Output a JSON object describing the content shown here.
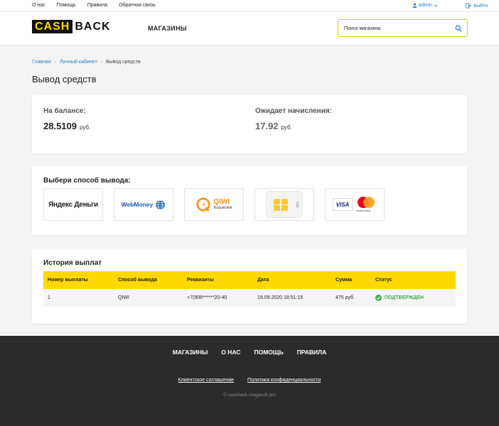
{
  "topbar": {
    "links": [
      "О нас",
      "Помощь",
      "Правила",
      "Обратная связь"
    ],
    "user": "admin",
    "logout": "выйти"
  },
  "header": {
    "logo_part1": "CASH",
    "logo_part2": "BACK",
    "nav_shops": "МАГАЗИНЫ",
    "search_placeholder": "Поиск магазина"
  },
  "breadcrumb": {
    "home": "Главная",
    "cabinet": "Личный кабинет",
    "current": "Вывод средств"
  },
  "page_title": "Вывод средств",
  "balance": {
    "label": "На балансе:",
    "value": "28.5109",
    "currency": "руб."
  },
  "pending": {
    "label": "Ожидает начисления:",
    "value": "17.92",
    "currency": "руб."
  },
  "methods": {
    "title": "Выбери способ вывода:",
    "items": [
      {
        "name": "Яндекс Деньги",
        "text": "Яндекс Деньги"
      },
      {
        "name": "WebMoney",
        "text": "WebMoney"
      },
      {
        "name": "QIWI",
        "text": "QIWI",
        "subtext": "Кошелек"
      },
      {
        "name": "SIM",
        "text": "SIM"
      },
      {
        "name": "Visa/Mastercard",
        "text": "VISA",
        "subtext": "mastercard"
      }
    ]
  },
  "history": {
    "title": "История выплат",
    "columns": [
      "Номер выплаты",
      "Способ вывода",
      "Реквизиты",
      "Дата",
      "Сумма",
      "Статус"
    ],
    "rows": [
      {
        "number": "1",
        "method": "QIWI",
        "details": "+7(908******20-40",
        "date": "19.09.2020 18:51:15",
        "amount": "475 руб.",
        "status": "ПОДТВЕРЖДЕН"
      }
    ]
  },
  "footer": {
    "nav": [
      "МАГАЗИНЫ",
      "О НАС",
      "ПОМОЩЬ",
      "ПРАВИЛА"
    ],
    "links": [
      "Клиентское соглашение",
      "Политика конфиденциальности"
    ],
    "copyright": "© cashback.megasoft.pro"
  },
  "colors": {
    "accent_yellow": "#ffd800",
    "link_blue": "#2f7dc1",
    "success_green": "#3fae49",
    "footer_bg": "#2b2b2b"
  }
}
